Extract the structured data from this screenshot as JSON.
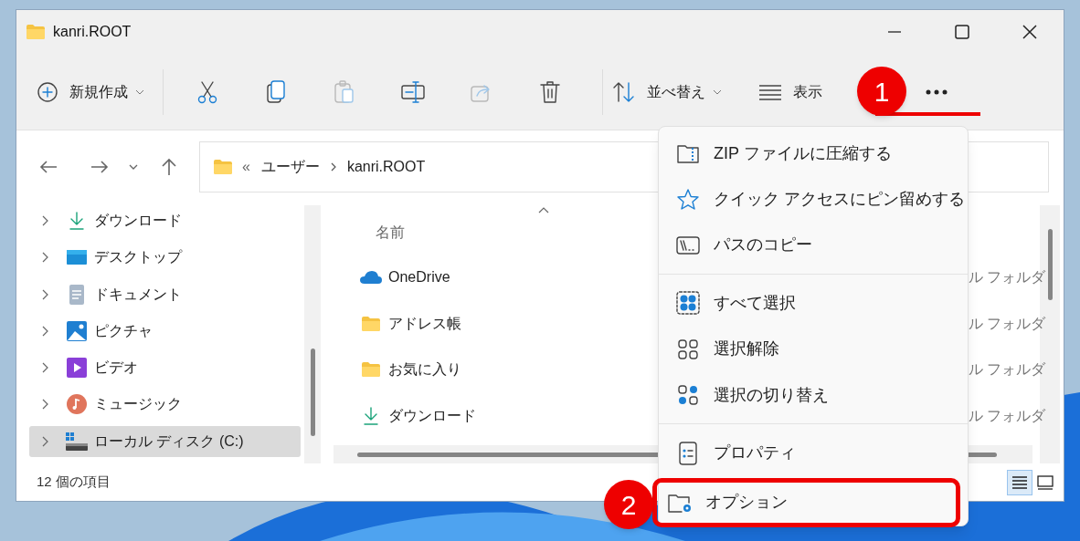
{
  "window": {
    "title": "kanri.ROOT"
  },
  "toolbar": [
    {
      "kind": "new",
      "label": "新規作成",
      "disabled": false
    },
    {
      "kind": "cut",
      "disabled": false
    },
    {
      "kind": "copy",
      "disabled": false
    },
    {
      "kind": "paste",
      "disabled": true
    },
    {
      "kind": "rename",
      "disabled": false
    },
    {
      "kind": "share",
      "disabled": true
    },
    {
      "kind": "delete",
      "disabled": false
    },
    {
      "kind": "sort",
      "label": "並べ替え",
      "disabled": false
    },
    {
      "kind": "view",
      "label": "表示",
      "disabled": false
    },
    {
      "kind": "more",
      "disabled": false
    }
  ],
  "address": {
    "overflow": "«",
    "path": [
      "ユーザー",
      "kanri.ROOT"
    ]
  },
  "sidebar": {
    "items": [
      {
        "label": "ダウンロード",
        "kind": "download",
        "selected": false
      },
      {
        "label": "デスクトップ",
        "kind": "desktop",
        "selected": false
      },
      {
        "label": "ドキュメント",
        "kind": "document",
        "selected": false
      },
      {
        "label": "ピクチャ",
        "kind": "picture",
        "selected": false
      },
      {
        "label": "ビデオ",
        "kind": "video",
        "selected": false
      },
      {
        "label": "ミュージック",
        "kind": "music",
        "selected": false
      },
      {
        "label": "ローカル ディスク (C:)",
        "kind": "disk",
        "selected": true
      }
    ]
  },
  "files": {
    "columns": [
      "名前"
    ],
    "rows": [
      {
        "name": "OneDrive",
        "kind": "cloud",
        "type": "ル フォルダ"
      },
      {
        "name": "アドレス帳",
        "kind": "folder",
        "type": "ル フォルダ"
      },
      {
        "name": "お気に入り",
        "kind": "folder",
        "type": "ル フォルダ"
      },
      {
        "name": "ダウンロード",
        "kind": "download",
        "type": "ル フォルダ"
      }
    ]
  },
  "status_bar": {
    "text": "12 個の項目",
    "views": [
      {
        "kind": "details",
        "selected": true
      },
      {
        "kind": "tiles",
        "selected": false
      }
    ]
  },
  "menu": {
    "groups": [
      [
        {
          "kind": "zip",
          "label": "ZIP ファイルに圧縮する",
          "annotated": false
        },
        {
          "kind": "star",
          "label": "クイック アクセスにピン留めする",
          "annotated": false
        },
        {
          "kind": "path",
          "label": "パスのコピー",
          "annotated": false
        }
      ],
      [
        {
          "kind": "selectall",
          "label": "すべて選択",
          "annotated": false
        },
        {
          "kind": "selectnone",
          "label": "選択解除",
          "annotated": false
        },
        {
          "kind": "invert",
          "label": "選択の切り替え",
          "annotated": false
        }
      ],
      [
        {
          "kind": "properties",
          "label": "プロパティ",
          "annotated": false
        },
        {
          "kind": "options",
          "label": "オプション",
          "annotated": true
        }
      ]
    ]
  },
  "annotations": [
    {
      "label": "1"
    },
    {
      "label": "2"
    }
  ]
}
